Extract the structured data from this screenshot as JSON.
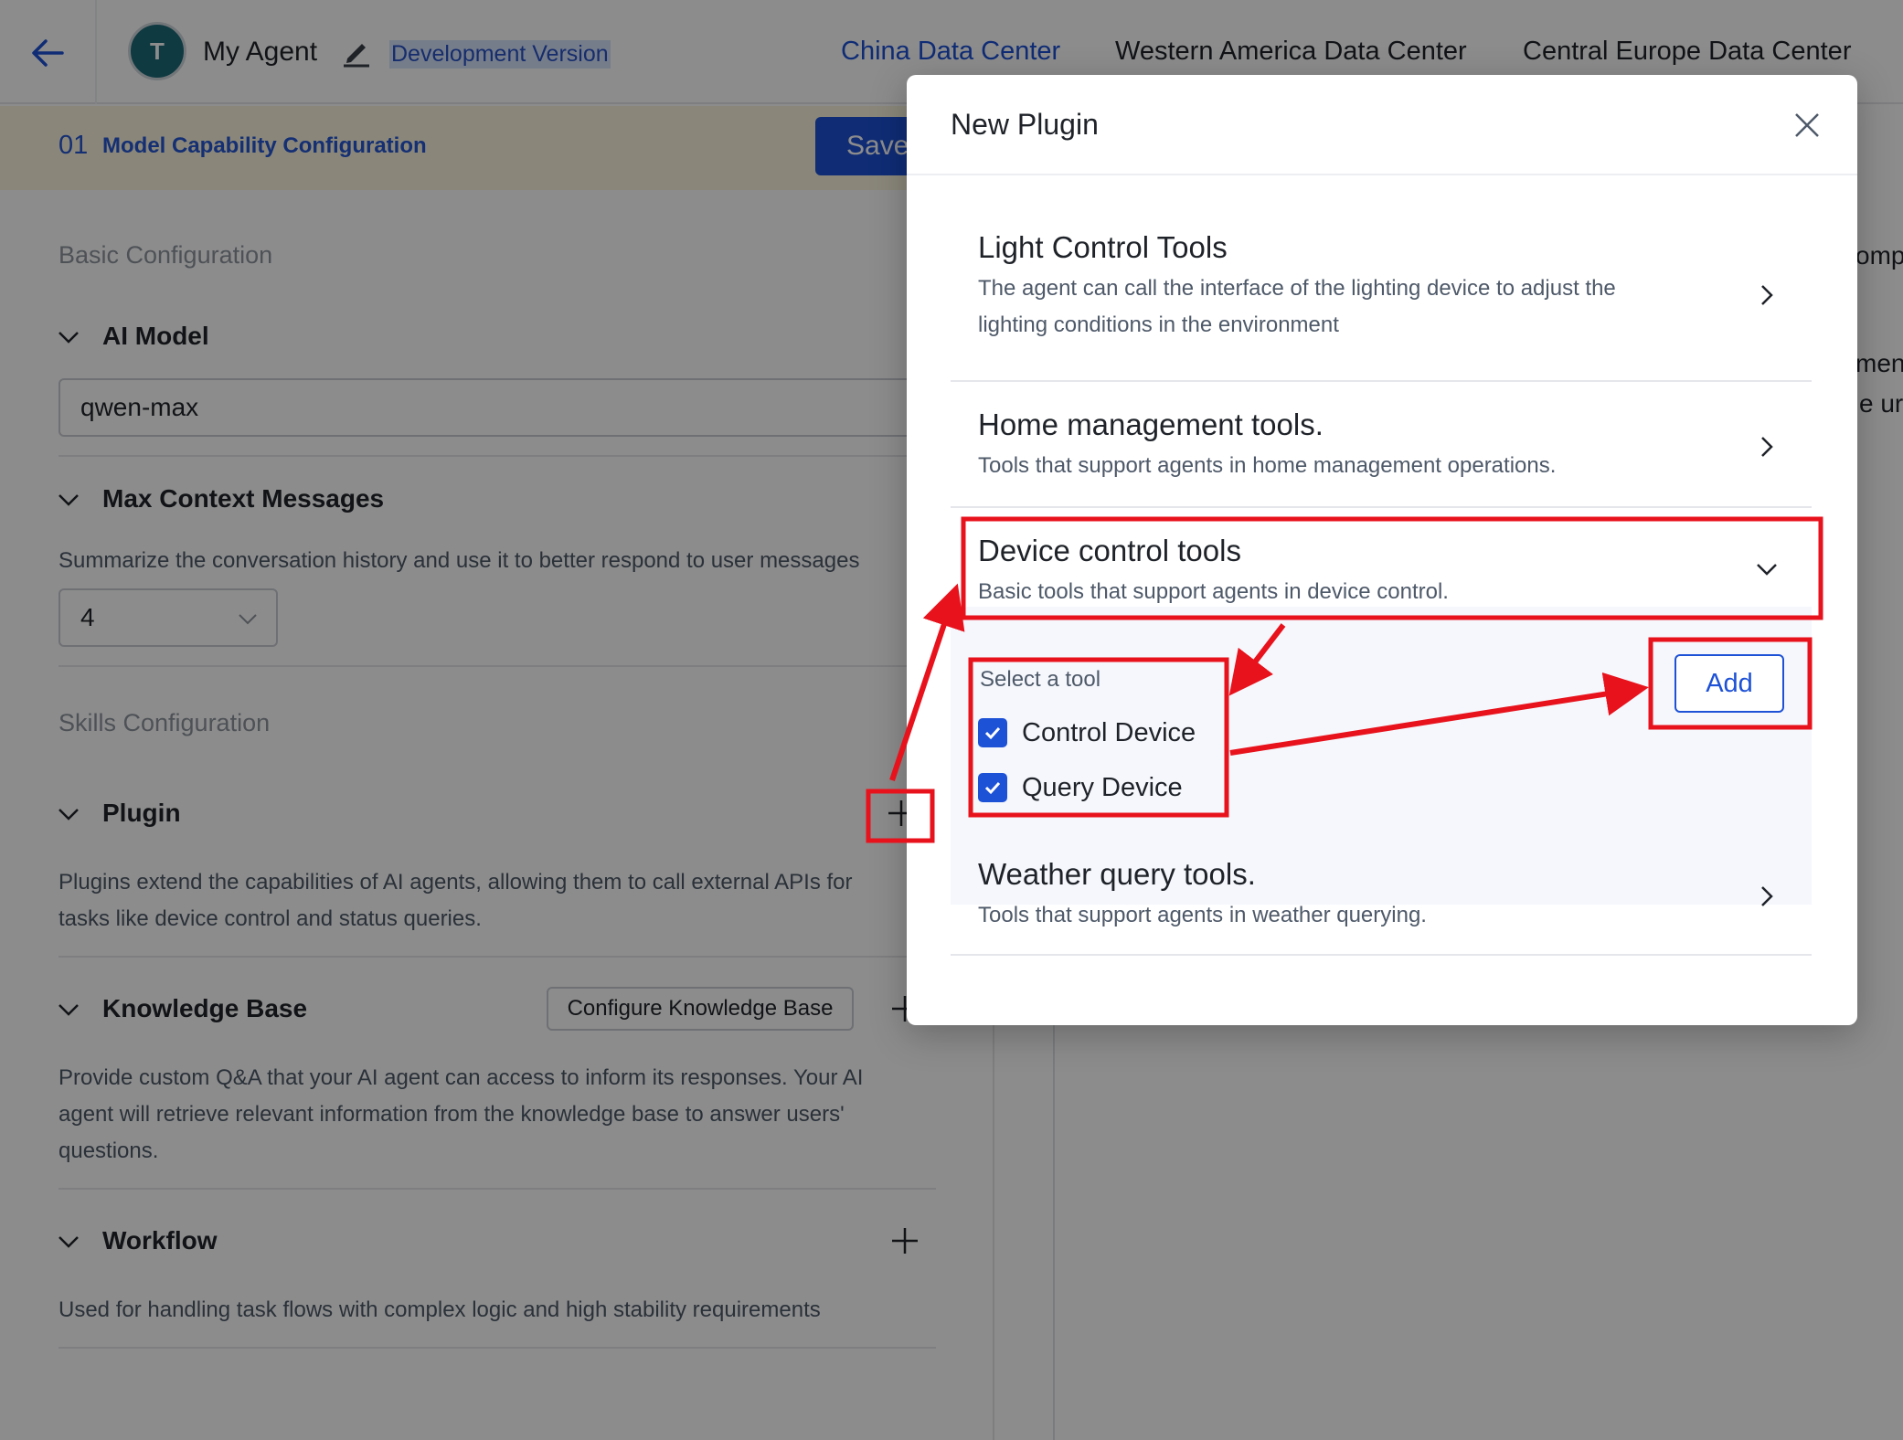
{
  "header": {
    "agent_name": "My Agent",
    "version_label": "Development Version",
    "avatar_text": "T",
    "data_centers": [
      "China Data Center",
      "Western America Data Center",
      "Central Europe Data Center"
    ],
    "active_data_center": "China Data Center"
  },
  "steps": {
    "number": "01",
    "label": "Model Capability Configuration",
    "save_label": "Save"
  },
  "basic_config": {
    "title": "Basic Configuration",
    "ai_model": {
      "label": "AI Model",
      "value": "qwen-max"
    },
    "max_context": {
      "label": "Max Context Messages",
      "description": "Summarize the conversation history and use it to better respond to user messages",
      "value": "4"
    }
  },
  "skills_config": {
    "title": "Skills Configuration",
    "plugin": {
      "label": "Plugin",
      "description_line1": "Plugins extend the capabilities of AI agents, allowing them to call external APIs for",
      "description_line2": "tasks like device control and status queries."
    },
    "knowledge_base": {
      "label": "Knowledge Base",
      "button": "Configure Knowledge Base",
      "description_line1": "Provide custom Q&A that your AI agent can access to inform its responses. Your AI",
      "description_line2": "agent will retrieve relevant information from the knowledge base to answer users'",
      "description_line3": "questions."
    },
    "workflow": {
      "label": "Workflow",
      "description": "Used for handling task flows with complex logic and high stability requirements"
    }
  },
  "right_panel_partial": {
    "text1": "ompt",
    "text2": "ment",
    "text3": "e ur"
  },
  "modal": {
    "title": "New Plugin",
    "plugins": [
      {
        "name": "Light Control Tools",
        "description_line1": "The agent can call the interface of the lighting device to adjust the",
        "description_line2": "lighting conditions in the environment",
        "state": "collapsed"
      },
      {
        "name": "Home management tools.",
        "description_line1": "Tools that support agents in home management operations.",
        "state": "collapsed"
      },
      {
        "name": "Device control tools",
        "description_line1": "Basic tools that support agents in device control.",
        "state": "expanded"
      },
      {
        "name": "Weather query tools.",
        "description_line1": "Tools that support agents in weather querying.",
        "state": "collapsed"
      }
    ],
    "tool_select": {
      "label": "Select a tool",
      "tools": [
        {
          "name": "Control Device",
          "checked": true
        },
        {
          "name": "Query Device",
          "checked": true
        }
      ],
      "add_label": "Add"
    }
  },
  "colors": {
    "accent": "#1d51d6",
    "annotation": "#e8121c",
    "step_bar": "#fcf6df"
  }
}
